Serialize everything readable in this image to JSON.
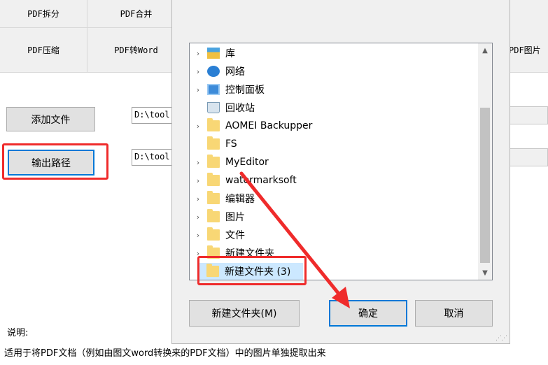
{
  "toolbar": {
    "pdf_split": "PDF拆分",
    "pdf_merge": "PDF合并",
    "pdf_compress": "PDF压缩",
    "pdf_to_word": "PDF转Word",
    "pdf_image": "PDF图片"
  },
  "main": {
    "add_file_label": "添加文件",
    "output_path_label": "输出路径",
    "add_file_path": "D:\\tool",
    "output_path": "D:\\tool",
    "desc_label": "说明:",
    "desc_text": "适用于将PDF文档（例如由图文word转换来的PDF文档）中的图片单独提取出来"
  },
  "dialog": {
    "tree": [
      {
        "label": "库",
        "icon": "library-icon",
        "expandable": true
      },
      {
        "label": "网络",
        "icon": "network-icon",
        "expandable": true
      },
      {
        "label": "控制面板",
        "icon": "control-panel-icon",
        "expandable": true
      },
      {
        "label": "回收站",
        "icon": "recycle-bin-icon",
        "expandable": false
      },
      {
        "label": "AOMEI Backupper",
        "icon": "folder-icon",
        "expandable": true
      },
      {
        "label": "FS",
        "icon": "folder-icon",
        "expandable": false
      },
      {
        "label": "MyEditor",
        "icon": "folder-icon",
        "expandable": true
      },
      {
        "label": "watermarksoft",
        "icon": "folder-icon",
        "expandable": true
      },
      {
        "label": "编辑器",
        "icon": "folder-icon",
        "expandable": true
      },
      {
        "label": "图片",
        "icon": "folder-icon",
        "expandable": true
      },
      {
        "label": "文件",
        "icon": "folder-icon",
        "expandable": true
      },
      {
        "label": "新建文件夹",
        "icon": "folder-icon",
        "expandable": true
      },
      {
        "label": "新建文件夹 (3)",
        "icon": "folder-icon",
        "expandable": false,
        "selected": true
      }
    ],
    "new_folder_label": "新建文件夹(M)",
    "ok_label": "确定",
    "cancel_label": "取消"
  },
  "colors": {
    "annotation": "#ef2b2b",
    "accent": "#0078d7",
    "selection": "#cce8ff"
  }
}
